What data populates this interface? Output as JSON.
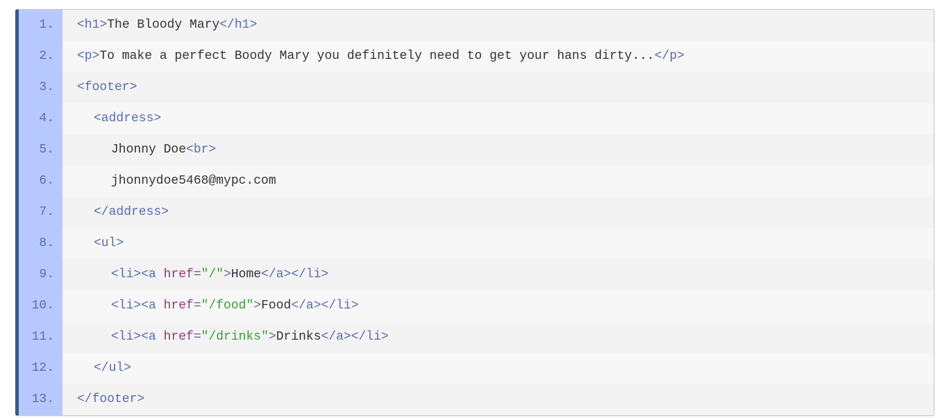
{
  "colors": {
    "gutter_bg": "#b6c8fd",
    "left_border": "#36598a",
    "tag": "#5c6bab",
    "attribute": "#8e3a7a",
    "string": "#3a9a3a",
    "text": "#333333"
  },
  "lines": [
    {
      "num": "1.",
      "open": "<h1>",
      "text": "The Bloody Mary",
      "close": "</h1>"
    },
    {
      "num": "2.",
      "open": "<p>",
      "text": "To make a perfect Boody Mary you definitely need to get your hans dirty...",
      "close": "</p>"
    },
    {
      "num": "3.",
      "open": "<footer>"
    },
    {
      "num": "4.",
      "open": "<address>"
    },
    {
      "num": "5.",
      "text": "Jhonny Doe",
      "tag": "<br>"
    },
    {
      "num": "6.",
      "text": "jhonnydoe5468@mypc.com"
    },
    {
      "num": "7.",
      "close": "</address>"
    },
    {
      "num": "8.",
      "open": "<ul>"
    },
    {
      "num": "9.",
      "li_open": "<li>",
      "a_open": "<a ",
      "attr": "href",
      "eq": "=",
      "value": "\"/\"",
      "gt": ">",
      "text": "Home",
      "a_close": "</a>",
      "li_close": "</li>"
    },
    {
      "num": "10.",
      "li_open": "<li>",
      "a_open": "<a ",
      "attr": "href",
      "eq": "=",
      "value": "\"/food\"",
      "gt": ">",
      "text": "Food",
      "a_close": "</a>",
      "li_close": "</li>"
    },
    {
      "num": "11.",
      "li_open": "<li>",
      "a_open": "<a ",
      "attr": "href",
      "eq": "=",
      "value": "\"/drinks\"",
      "gt": ">",
      "text": "Drinks",
      "a_close": "</a>",
      "li_close": "</li>"
    },
    {
      "num": "12.",
      "close": "</ul>"
    },
    {
      "num": "13.",
      "close": "</footer>"
    }
  ]
}
